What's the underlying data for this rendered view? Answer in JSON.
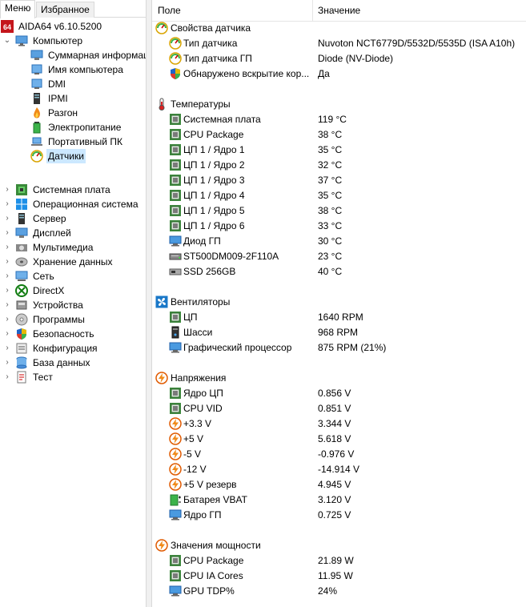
{
  "tabs": {
    "menu": "Меню",
    "favorites": "Избранное"
  },
  "tree": {
    "root": "AIDA64 v6.10.5200",
    "computer": "Компьютер",
    "children": [
      "Суммарная информация",
      "Имя компьютера",
      "DMI",
      "IPMI",
      "Разгон",
      "Электропитание",
      "Портативный ПК",
      "Датчики"
    ],
    "items": [
      "Системная плата",
      "Операционная система",
      "Сервер",
      "Дисплей",
      "Мультимедиа",
      "Хранение данных",
      "Сеть",
      "DirectX",
      "Устройства",
      "Программы",
      "Безопасность",
      "Конфигурация",
      "База данных",
      "Тест"
    ]
  },
  "columns": {
    "field": "Поле",
    "value": "Значение"
  },
  "sections": [
    {
      "title": "Свойства датчика",
      "rows": [
        {
          "f": "Тип датчика",
          "v": "Nuvoton NCT6779D/5532D/5535D  (ISA A10h)"
        },
        {
          "f": "Тип датчика ГП",
          "v": "Diode  (NV-Diode)"
        },
        {
          "f": "Обнаружено вскрытие кор...",
          "v": "Да"
        }
      ]
    },
    {
      "title": "Температуры",
      "rows": [
        {
          "f": "Системная плата",
          "v": "119 °C"
        },
        {
          "f": "CPU Package",
          "v": "38 °C"
        },
        {
          "f": "ЦП 1 / Ядро 1",
          "v": "35 °C"
        },
        {
          "f": "ЦП 1 / Ядро 2",
          "v": "32 °C"
        },
        {
          "f": "ЦП 1 / Ядро 3",
          "v": "37 °C"
        },
        {
          "f": "ЦП 1 / Ядро 4",
          "v": "35 °C"
        },
        {
          "f": "ЦП 1 / Ядро 5",
          "v": "38 °C"
        },
        {
          "f": "ЦП 1 / Ядро 6",
          "v": "33 °C"
        },
        {
          "f": "Диод ГП",
          "v": "30 °C"
        },
        {
          "f": "ST500DM009-2F110A",
          "v": "23 °C"
        },
        {
          "f": "SSD 256GB",
          "v": "40 °C"
        }
      ]
    },
    {
      "title": "Вентиляторы",
      "rows": [
        {
          "f": "ЦП",
          "v": "1640 RPM"
        },
        {
          "f": "Шасси",
          "v": "968 RPM"
        },
        {
          "f": "Графический процессор",
          "v": "875 RPM  (21%)"
        }
      ]
    },
    {
      "title": "Напряжения",
      "rows": [
        {
          "f": "Ядро ЦП",
          "v": "0.856 V"
        },
        {
          "f": "CPU VID",
          "v": "0.851 V"
        },
        {
          "f": "+3.3 V",
          "v": "3.344 V"
        },
        {
          "f": "+5 V",
          "v": "5.618 V"
        },
        {
          "f": "-5 V",
          "v": "-0.976 V"
        },
        {
          "f": "-12 V",
          "v": "-14.914 V"
        },
        {
          "f": "+5 V резерв",
          "v": "4.945 V"
        },
        {
          "f": "Батарея VBAT",
          "v": "3.120 V"
        },
        {
          "f": "Ядро ГП",
          "v": "0.725 V"
        }
      ]
    },
    {
      "title": "Значения мощности",
      "rows": [
        {
          "f": "CPU Package",
          "v": "21.89 W"
        },
        {
          "f": "CPU IA Cores",
          "v": "11.95 W"
        },
        {
          "f": "GPU TDP%",
          "v": "24%"
        }
      ]
    }
  ]
}
